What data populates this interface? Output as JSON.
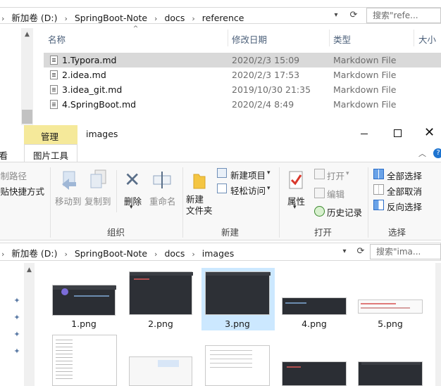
{
  "top_window": {
    "address": {
      "segments": [
        "新加卷 (D:)",
        "SpringBoot-Note",
        "docs",
        "reference"
      ],
      "search_placeholder": "搜索\"refe..."
    },
    "columns": {
      "name": "名称",
      "date": "修改日期",
      "type": "类型",
      "size": "大小"
    },
    "files": [
      {
        "name": "1.Typora.md",
        "date": "2020/2/3 15:09",
        "type": "Markdown File",
        "selected": true
      },
      {
        "name": "2.idea.md",
        "date": "2020/2/3 17:53",
        "type": "Markdown File",
        "selected": false
      },
      {
        "name": "3.idea_git.md",
        "date": "2019/10/30 21:35",
        "type": "Markdown File",
        "selected": false
      },
      {
        "name": "4.SpringBoot.md",
        "date": "2020/2/4 8:49",
        "type": "Markdown File",
        "selected": false
      }
    ]
  },
  "bottom_window": {
    "title": "images",
    "tabs": {
      "manage": "管理",
      "view_left": "查看",
      "picture_tools": "图片工具"
    },
    "ribbon": {
      "copy_path": "复制路径",
      "paste_shortcut": "粘贴快捷方式",
      "move_to": "移动到",
      "copy_to": "复制到",
      "delete": "删除",
      "rename": "重命名",
      "new_folder": "新建\n文件夹",
      "new_item": "新建项目",
      "easy_access": "轻松访问",
      "properties": "属性",
      "open": "打开",
      "edit": "编辑",
      "history": "历史记录",
      "select_all": "全部选择",
      "select_none": "全部取消",
      "invert_selection": "反向选择",
      "group_organize": "组织",
      "group_new": "新建",
      "group_open": "打开",
      "group_select": "选择"
    },
    "address": {
      "segments": [
        "新加卷 (D:)",
        "SpringBoot-Note",
        "docs",
        "images"
      ],
      "search_placeholder": "搜索\"ima..."
    },
    "images": [
      {
        "label": "1.png"
      },
      {
        "label": "2.png"
      },
      {
        "label": "3.png",
        "selected": true
      },
      {
        "label": "4.png"
      },
      {
        "label": "5.png"
      }
    ]
  },
  "colors": {
    "accent_tab": "#f5e99a",
    "selection": "#cce8ff",
    "header_text": "#4c607a"
  }
}
